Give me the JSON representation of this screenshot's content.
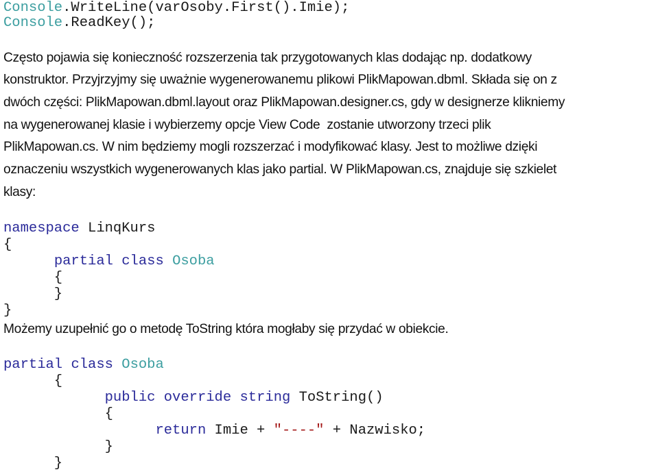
{
  "code_block_1": {
    "lines": [
      [
        {
          "text": "Console",
          "kind": "type"
        },
        {
          "text": ".WriteLine(varOsoby.First().Imie);",
          "kind": "plain"
        }
      ],
      [
        {
          "text": "Console",
          "kind": "type"
        },
        {
          "text": ".ReadKey();",
          "kind": "plain"
        }
      ]
    ]
  },
  "paragraph_1": {
    "lines": [
      "Często pojawia się konieczność rozszerzenia tak przygotowanych klas dodając np. dodatkowy",
      "konstruktor. Przyjrzyjmy się uważnie wygenerowanemu plikowi PlikMapowan.dbml. Składa się on z",
      "dwóch części: PlikMapowan.dbml.layout oraz PlikMapowan.designer.cs, gdy w designerze klikniemy",
      "na wygenerowanej klasie i wybierzemy opcje View Code  zostanie utworzony trzeci plik",
      "PlikMapowan.cs. W nim będziemy mogli rozszerzać i modyfikować klasy. Jest to możliwe dzięki",
      "oznaczeniu wszystkich wygenerowanych klas jako partial. W PlikMapowan.cs, znajduje się szkielet",
      "klasy:"
    ]
  },
  "code_block_2": {
    "lines": [
      [
        {
          "text": "namespace",
          "kind": "kw"
        },
        {
          "text": " LinqKurs",
          "kind": "plain"
        }
      ],
      [
        {
          "text": "{",
          "kind": "plain"
        }
      ],
      [
        {
          "text": "      ",
          "kind": "plain"
        },
        {
          "text": "partial",
          "kind": "kw"
        },
        {
          "text": " ",
          "kind": "plain"
        },
        {
          "text": "class",
          "kind": "kw"
        },
        {
          "text": " ",
          "kind": "plain"
        },
        {
          "text": "Osoba",
          "kind": "type"
        }
      ],
      [
        {
          "text": "      {",
          "kind": "plain"
        }
      ],
      [
        {
          "text": "      }",
          "kind": "plain"
        }
      ],
      [
        {
          "text": "}",
          "kind": "plain"
        }
      ]
    ]
  },
  "paragraph_2": {
    "lines": [
      "Możemy uzupełnić go o metodę ToString która mogłaby się przydać w obiekcie."
    ]
  },
  "code_block_3": {
    "lines": [
      [
        {
          "text": "partial",
          "kind": "kw"
        },
        {
          "text": " ",
          "kind": "plain"
        },
        {
          "text": "class",
          "kind": "kw"
        },
        {
          "text": " ",
          "kind": "plain"
        },
        {
          "text": "Osoba",
          "kind": "type"
        }
      ],
      [
        {
          "text": "      {",
          "kind": "plain"
        }
      ],
      [
        {
          "text": "            ",
          "kind": "plain"
        },
        {
          "text": "public",
          "kind": "kw"
        },
        {
          "text": " ",
          "kind": "plain"
        },
        {
          "text": "override",
          "kind": "kw"
        },
        {
          "text": " ",
          "kind": "plain"
        },
        {
          "text": "string",
          "kind": "kw"
        },
        {
          "text": " ToString()",
          "kind": "plain"
        }
      ],
      [
        {
          "text": "            {",
          "kind": "plain"
        }
      ],
      [
        {
          "text": "                  ",
          "kind": "plain"
        },
        {
          "text": "return",
          "kind": "kw"
        },
        {
          "text": " Imie + ",
          "kind": "plain"
        },
        {
          "text": "\"----\"",
          "kind": "str"
        },
        {
          "text": " + Nazwisko;",
          "kind": "plain"
        }
      ],
      [
        {
          "text": "            }",
          "kind": "plain"
        }
      ],
      [
        {
          "text": "      }",
          "kind": "plain"
        }
      ]
    ]
  },
  "colors": {
    "keyword": "#2b2b9a",
    "type": "#3c9ea0",
    "string": "#a31515",
    "text": "#111111",
    "background": "#ffffff"
  }
}
